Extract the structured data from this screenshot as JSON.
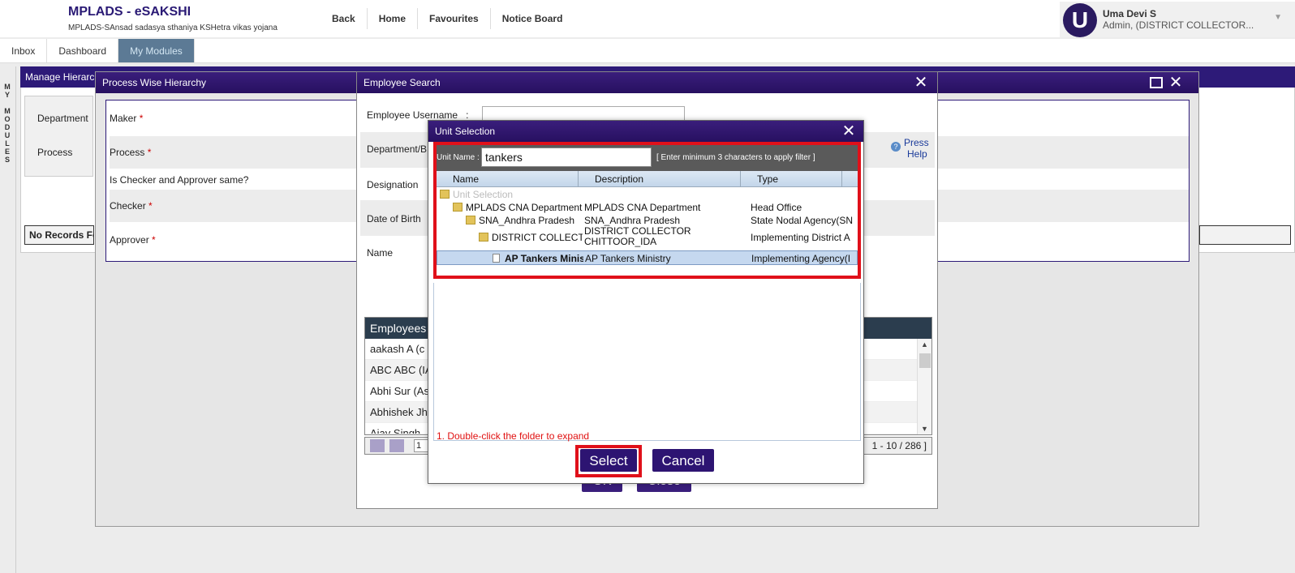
{
  "header": {
    "title": "MPLADS - eSAKSHI",
    "subtitle": "MPLADS-SAnsad sadasya sthaniya KSHetra vikas yojana",
    "nav": [
      "Back",
      "Home",
      "Favourites",
      "Notice Board"
    ],
    "user_initial": "U",
    "user_name": "Uma Devi S",
    "user_role": "Admin, (DISTRICT COLLECTOR..."
  },
  "tabs": [
    "Inbox",
    "Dashboard",
    "My Modules"
  ],
  "sidebar_label": "MY MODULES",
  "manage": {
    "title": "Manage Hierarc",
    "department_label": "Department",
    "process_label": "Process",
    "no_records": "No Records Fo"
  },
  "process_dialog": {
    "title": "Process Wise Hierarchy",
    "maker": "Maker",
    "process": "Process",
    "checker_same": "Is Checker and Approver same?",
    "checker": "Checker",
    "approver": "Approver",
    "required": "*"
  },
  "employee_dialog": {
    "title": "Employee Search",
    "username_label": "Employee Username",
    "colon": ":",
    "department_label": "Department/B",
    "designation_label": "Designation",
    "dob_label": "Date of Birth",
    "name_label": "Name",
    "help_line1": "Press",
    "help_line2": "Help",
    "grid_header": "Employees",
    "rows": [
      "aakash A (c",
      "ABC ABC (IA",
      "Abhi Sur (As",
      "Abhishek Jh",
      "Ajay Singh"
    ],
    "page_number": "1",
    "record_count": "1 - 10 / 286 ]",
    "ok_label": "OK",
    "close_label": "Close"
  },
  "unit_dialog": {
    "title": "Unit Selection",
    "filter_label": "Unit Name :",
    "filter_value": "tankers",
    "filter_hint": "[ Enter minimum 3 characters to apply filter ]",
    "columns": [
      "Name",
      "Description",
      "Type"
    ],
    "tree": [
      {
        "name": "Unit Selection",
        "description": "",
        "type": ""
      },
      {
        "name": "MPLADS CNA Department",
        "description": "MPLADS CNA Department",
        "type": "Head Office"
      },
      {
        "name": "SNA_Andhra Pradesh",
        "description": "SNA_Andhra Pradesh",
        "type": "State Nodal Agency(SN"
      },
      {
        "name": "DISTRICT COLLECT",
        "description": "DISTRICT COLLECTOR CHITTOOR_IDA",
        "type": "Implementing District A"
      },
      {
        "name": "AP Tankers Minis",
        "description": "AP Tankers Ministry",
        "type": "Implementing Agency(I"
      }
    ],
    "note": "1. Double-click the folder to expand",
    "select_label": "Select",
    "cancel_label": "Cancel"
  },
  "colors": {
    "brand": "#2a1a75",
    "dialog_header": "#2d1a78",
    "highlight": "#e0101a",
    "selected_row": "#c5d8ef"
  }
}
